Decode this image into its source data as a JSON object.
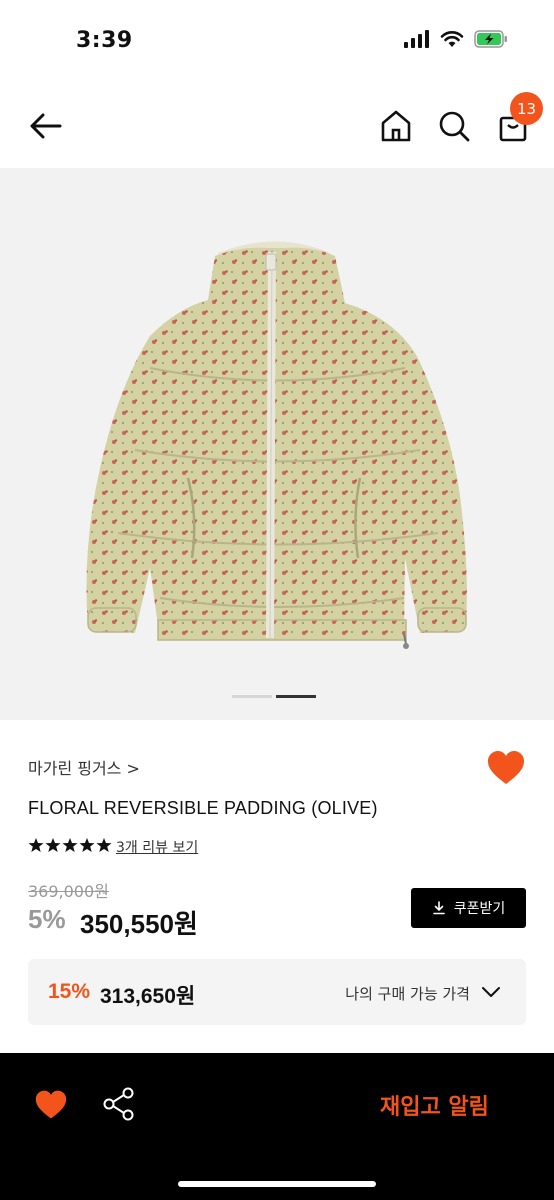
{
  "status_bar": {
    "time": "3:39"
  },
  "header": {
    "cart_count": "13"
  },
  "product": {
    "brand": "마가린 핑거스 >",
    "name": "FLORAL REVERSIBLE PADDING (OLIVE)",
    "rating_stars": 5,
    "review_link": "3개 리뷰 보기",
    "original_price": "369,000원",
    "discount_rate": "5%",
    "sale_price": "350,550원",
    "coupon_label": "쿠폰받기",
    "image_count": 2,
    "current_image": 2
  },
  "my_price": {
    "rate": "15%",
    "price": "313,650원",
    "label": "나의 구매 가능 가격"
  },
  "bottom_bar": {
    "restock_label": "재입고 알림"
  },
  "colors": {
    "accent": "#f2541b",
    "jacket": "#d4d1a3",
    "flower": "#c7675a"
  }
}
